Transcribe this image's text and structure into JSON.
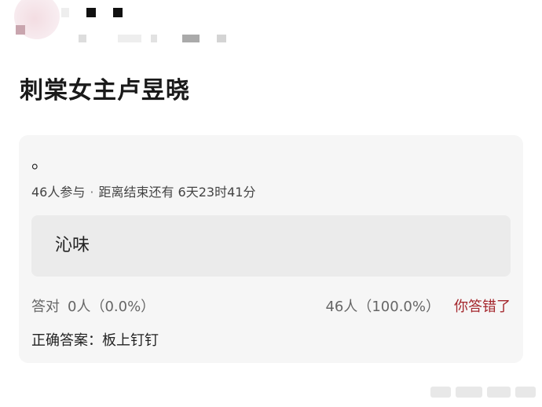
{
  "post": {
    "title": "刺棠女主卢昱晓"
  },
  "quiz": {
    "question": "。",
    "participants": "46人参与",
    "separator": "·",
    "time_left": "距离结束还有 6天23时41分",
    "option": "沁味",
    "correct_label": "答对",
    "correct_count": "0人（0.0%）",
    "wrong_count": "46人（100.0%）",
    "result_status": "你答错了",
    "answer_label": "正确答案：",
    "answer_value": "板上钉钉"
  },
  "colors": {
    "card_background": "#f6f6f6",
    "option_background": "#ebebeb",
    "wrong_status": "#a4262c"
  }
}
